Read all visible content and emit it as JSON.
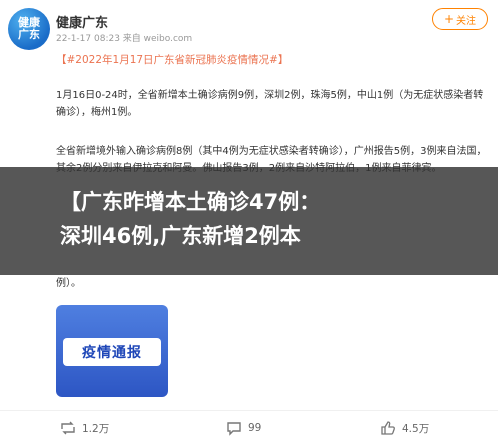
{
  "account": {
    "avatar_text_line1": "健康",
    "avatar_text_line2": "广东",
    "name": "健康广东",
    "meta": "22-1-17 08:23 来自 weibo.com",
    "follow_label": "关注"
  },
  "post": {
    "hashtag": "【#2022年1月17日广东省新冠肺炎疫情情况#】",
    "para1": "1月16日0-24时，全省新增本土确诊病例9例，深圳2例，珠海5例，中山1例（为无症状感染者转确诊），梅州1例。",
    "para2": "全省新增境外输入确诊病例8例（其中4例为无症状感染者转确诊），广州报告5例，3例来自法国，其余2例分别来自伊拉克和阿曼。佛山报告3例，2例来自沙特阿拉伯，1例来自菲律宾。",
    "headline_line1": "【广东昨增本土确诊47例：",
    "headline_line2": "深圳46例,广东新增2例本",
    "para3": "例）。",
    "video_banner": "疫情通报"
  },
  "actions": {
    "repost_count": "1.2万",
    "comment_count": "99",
    "like_count": "4.5万"
  },
  "colors": {
    "accent": "#ff8200",
    "hashtag": "#eb7350",
    "overlay": "#323232"
  }
}
